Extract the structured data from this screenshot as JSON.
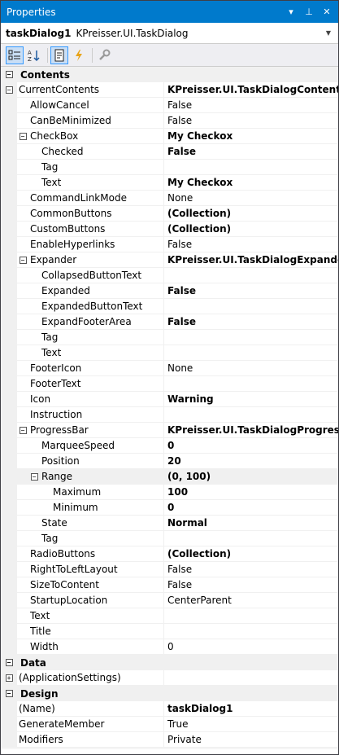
{
  "panel": {
    "title": "Properties",
    "dropdown_icon": "▾",
    "pin_icon": "⊥",
    "close_icon": "✕"
  },
  "object_selector": {
    "name": "taskDialog1",
    "type": "KPreisser.UI.TaskDialog"
  },
  "toolbar": {
    "buttons": [
      {
        "name": "categorized-icon",
        "active": true
      },
      {
        "name": "alphabetical-icon",
        "active": false
      },
      {
        "name": "properties-icon",
        "active": true
      },
      {
        "name": "events-icon",
        "active": false
      },
      {
        "name": "property-pages-icon",
        "active": false
      }
    ]
  },
  "rows": [
    {
      "type": "category",
      "label": "Contents",
      "expander": "−"
    },
    {
      "label": "CurrentContents",
      "value": "KPreisser.UI.TaskDialogContents",
      "bold": true,
      "level": 0,
      "expander": "−"
    },
    {
      "label": "AllowCancel",
      "value": "False",
      "bold": false,
      "level": 1
    },
    {
      "label": "CanBeMinimized",
      "value": "False",
      "bold": false,
      "level": 1
    },
    {
      "label": "CheckBox",
      "value": "My Checkox",
      "bold": true,
      "level": 1,
      "expander": "−"
    },
    {
      "label": "Checked",
      "value": "False",
      "bold": true,
      "level": 2
    },
    {
      "label": "Tag",
      "value": "",
      "bold": false,
      "level": 2
    },
    {
      "label": "Text",
      "value": "My Checkox",
      "bold": true,
      "level": 2
    },
    {
      "label": "CommandLinkMode",
      "value": "None",
      "bold": false,
      "level": 1
    },
    {
      "label": "CommonButtons",
      "value": "(Collection)",
      "bold": true,
      "level": 1
    },
    {
      "label": "CustomButtons",
      "value": "(Collection)",
      "bold": true,
      "level": 1
    },
    {
      "label": "EnableHyperlinks",
      "value": "False",
      "bold": false,
      "level": 1
    },
    {
      "label": "Expander",
      "value": "KPreisser.UI.TaskDialogExpander",
      "bold": true,
      "level": 1,
      "expander": "−"
    },
    {
      "label": "CollapsedButtonText",
      "value": "",
      "bold": false,
      "level": 2
    },
    {
      "label": "Expanded",
      "value": "False",
      "bold": true,
      "level": 2
    },
    {
      "label": "ExpandedButtonText",
      "value": "",
      "bold": false,
      "level": 2
    },
    {
      "label": "ExpandFooterArea",
      "value": "False",
      "bold": true,
      "level": 2
    },
    {
      "label": "Tag",
      "value": "",
      "bold": false,
      "level": 2
    },
    {
      "label": "Text",
      "value": "",
      "bold": false,
      "level": 2
    },
    {
      "label": "FooterIcon",
      "value": "None",
      "bold": false,
      "level": 1
    },
    {
      "label": "FooterText",
      "value": "",
      "bold": false,
      "level": 1
    },
    {
      "label": "Icon",
      "value": "Warning",
      "bold": true,
      "level": 1
    },
    {
      "label": "Instruction",
      "value": "",
      "bold": false,
      "level": 1
    },
    {
      "label": "ProgressBar",
      "value": "KPreisser.UI.TaskDialogProgressBar",
      "bold": true,
      "level": 1,
      "expander": "−"
    },
    {
      "label": "MarqueeSpeed",
      "value": "0",
      "bold": true,
      "level": 2
    },
    {
      "label": "Position",
      "value": "20",
      "bold": true,
      "level": 2
    },
    {
      "label": "Range",
      "value": "(0, 100)",
      "bold": true,
      "level": 2,
      "expander": "−",
      "shaded": true
    },
    {
      "label": "Maximum",
      "value": "100",
      "bold": true,
      "level": 3
    },
    {
      "label": "Minimum",
      "value": "0",
      "bold": true,
      "level": 3
    },
    {
      "label": "State",
      "value": "Normal",
      "bold": true,
      "level": 2
    },
    {
      "label": "Tag",
      "value": "",
      "bold": false,
      "level": 2
    },
    {
      "label": "RadioButtons",
      "value": "(Collection)",
      "bold": true,
      "level": 1
    },
    {
      "label": "RightToLeftLayout",
      "value": "False",
      "bold": false,
      "level": 1
    },
    {
      "label": "SizeToContent",
      "value": "False",
      "bold": false,
      "level": 1
    },
    {
      "label": "StartupLocation",
      "value": "CenterParent",
      "bold": false,
      "level": 1
    },
    {
      "label": "Text",
      "value": "",
      "bold": false,
      "level": 1
    },
    {
      "label": "Title",
      "value": "",
      "bold": false,
      "level": 1
    },
    {
      "label": "Width",
      "value": "0",
      "bold": false,
      "level": 1
    },
    {
      "type": "category",
      "label": "Data",
      "expander": "−"
    },
    {
      "label": "(ApplicationSettings)",
      "value": "",
      "bold": false,
      "level": 0,
      "expander": "+"
    },
    {
      "type": "category",
      "label": "Design",
      "expander": "−"
    },
    {
      "label": "(Name)",
      "value": "taskDialog1",
      "bold": true,
      "level": 0
    },
    {
      "label": "GenerateMember",
      "value": "True",
      "bold": false,
      "level": 0
    },
    {
      "label": "Modifiers",
      "value": "Private",
      "bold": false,
      "level": 0
    }
  ]
}
